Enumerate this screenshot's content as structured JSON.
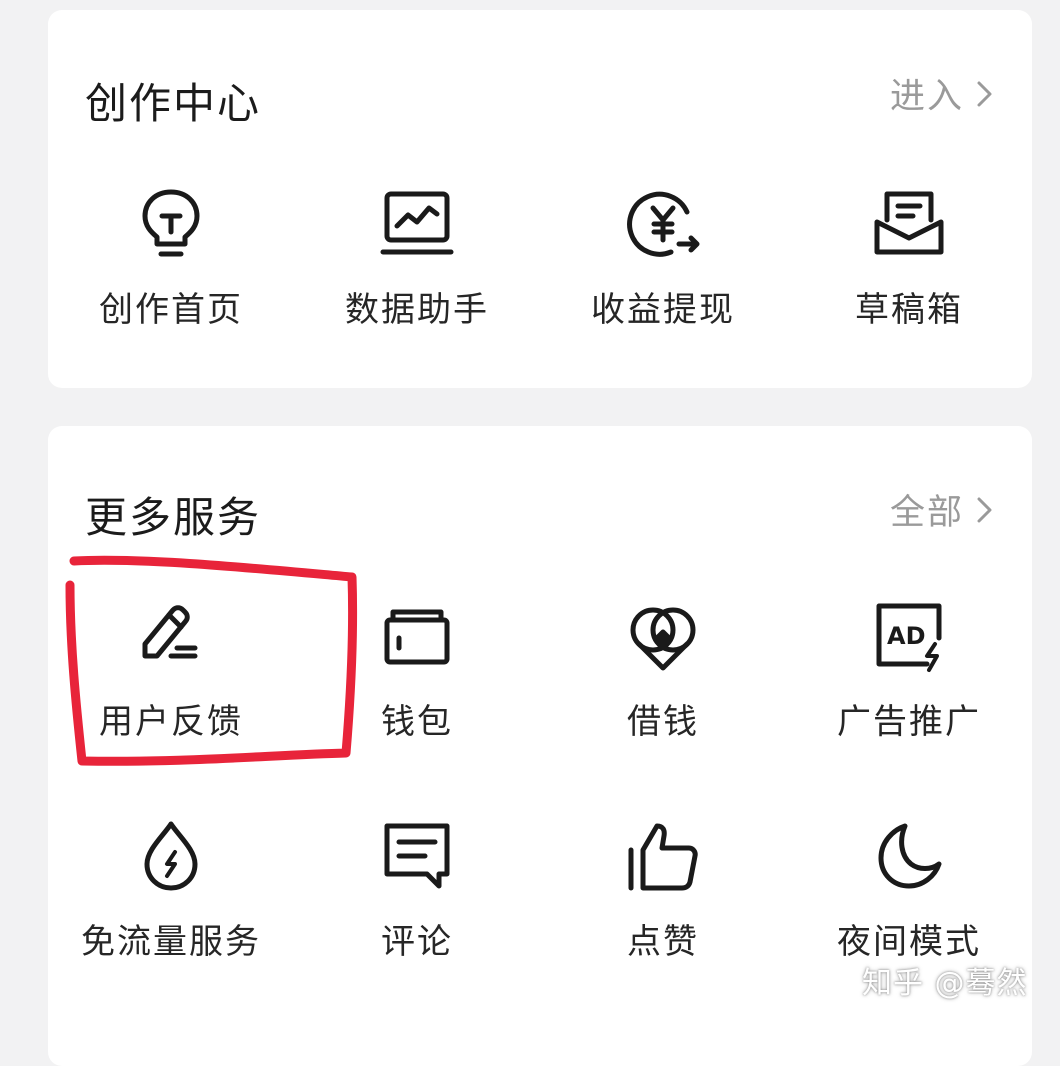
{
  "creation_center": {
    "title": "创作中心",
    "action_label": "进入",
    "items": [
      {
        "label": "创作首页",
        "icon": "lightbulb-icon"
      },
      {
        "label": "数据助手",
        "icon": "chart-monitor-icon"
      },
      {
        "label": "收益提现",
        "icon": "yuan-withdraw-icon"
      },
      {
        "label": "草稿箱",
        "icon": "drafts-inbox-icon"
      }
    ]
  },
  "more_services": {
    "title": "更多服务",
    "action_label": "全部",
    "items": [
      {
        "label": "用户反馈",
        "icon": "pen-feedback-icon"
      },
      {
        "label": "钱包",
        "icon": "wallet-icon"
      },
      {
        "label": "借钱",
        "icon": "loan-icon"
      },
      {
        "label": "广告推广",
        "icon": "ad-promo-icon"
      },
      {
        "label": "免流量服务",
        "icon": "data-drop-icon"
      },
      {
        "label": "评论",
        "icon": "comment-icon"
      },
      {
        "label": "点赞",
        "icon": "thumbs-up-icon"
      },
      {
        "label": "夜间模式",
        "icon": "moon-icon"
      }
    ]
  },
  "watermark": "知乎 @蓦然",
  "colors": {
    "background": "#f2f2f3",
    "card": "#ffffff",
    "text": "#1a1a1a",
    "muted": "#9a9a9a",
    "highlight": "#e8243a"
  }
}
